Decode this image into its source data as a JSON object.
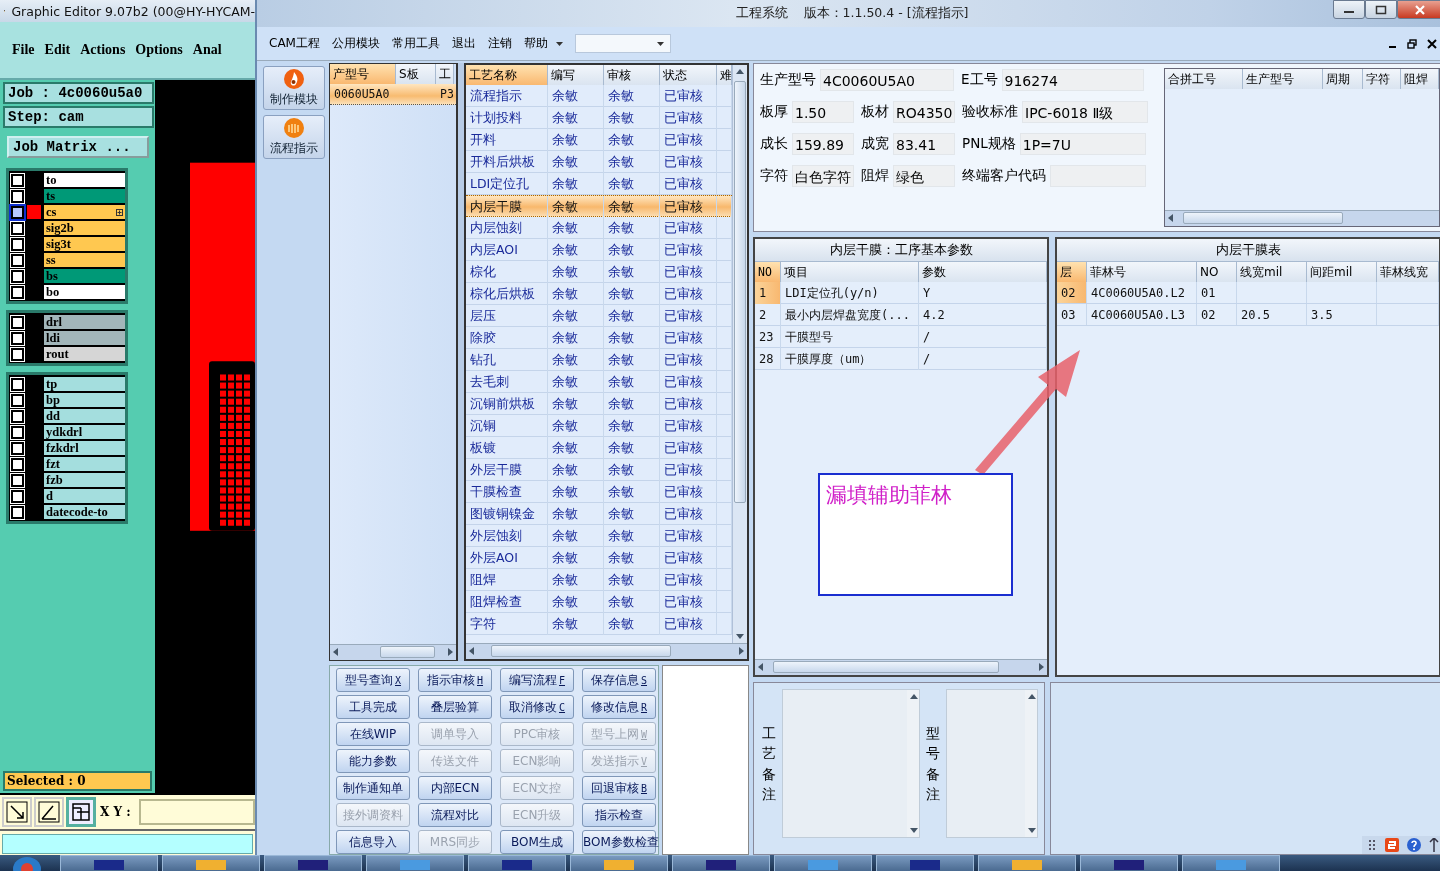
{
  "editor": {
    "title": "Graphic Editor 9.07b2 (00@HY-HYCAM-",
    "menu": [
      "File",
      "Edit",
      "Actions",
      "Options",
      "Anal"
    ],
    "job": "Job : 4c0060u5a0",
    "step": "Step: cam",
    "matrix_button": "Job Matrix ...",
    "layer_groups": [
      [
        {
          "name": "to",
          "color": "#ffffff",
          "selected": false
        },
        {
          "name": "ts",
          "color": "#009977",
          "selected": false
        },
        {
          "name": "cs",
          "color": "#ffc850",
          "selected": true
        },
        {
          "name": "sig2b",
          "color": "#ffc850",
          "selected": false
        },
        {
          "name": "sig3t",
          "color": "#ffc850",
          "selected": false
        },
        {
          "name": "ss",
          "color": "#ffc850",
          "selected": false
        },
        {
          "name": "bs",
          "color": "#009977",
          "selected": false
        },
        {
          "name": "bo",
          "color": "#ffffff",
          "selected": false
        }
      ],
      [
        {
          "name": "drl",
          "color": "#a2b6ba",
          "selected": false
        },
        {
          "name": "ldi",
          "color": "#a2b6ba",
          "selected": false
        },
        {
          "name": "rout",
          "color": "#d6d6d6",
          "selected": false
        }
      ],
      [
        {
          "name": "tp",
          "color": "#a4dede",
          "selected": false
        },
        {
          "name": "bp",
          "color": "#a4dede",
          "selected": false
        },
        {
          "name": "dd",
          "color": "#a4dede",
          "selected": false
        },
        {
          "name": "ydkdrl",
          "color": "#a4dede",
          "selected": false
        },
        {
          "name": "fzkdrl",
          "color": "#a4dede",
          "selected": false
        },
        {
          "name": "fzt",
          "color": "#a4dede",
          "selected": false
        },
        {
          "name": "fzb",
          "color": "#a4dede",
          "selected": false
        },
        {
          "name": "d",
          "color": "#a4dede",
          "selected": false
        },
        {
          "name": "datecode-to",
          "color": "#a4dede",
          "selected": false
        }
      ]
    ],
    "selected_count": "Selected : 0",
    "xy_label": "X Y :"
  },
  "app": {
    "title": "工程系统",
    "version": "版本：1.1.50.4 - [流程指示]",
    "menu": [
      "CAM工程",
      "公用模块",
      "常用工具",
      "退出",
      "注销",
      "帮助"
    ],
    "nav": [
      "制作模块",
      "流程指示"
    ],
    "products": {
      "columns": [
        "产型号",
        "S板",
        "工"
      ],
      "rows": [
        {
          "model": "0060U5A0",
          "column_3": "P3",
          "selected": true
        }
      ]
    },
    "process": {
      "columns": [
        "工艺名称",
        "编写",
        "审核",
        "状态",
        "难"
      ],
      "rows": [
        {
          "cells": [
            "流程指示",
            "余敏",
            "余敏",
            "已审核"
          ],
          "selected": false
        },
        {
          "cells": [
            "计划投料",
            "余敏",
            "余敏",
            "已审核"
          ],
          "selected": false
        },
        {
          "cells": [
            "开料",
            "余敏",
            "余敏",
            "已审核"
          ],
          "selected": false
        },
        {
          "cells": [
            "开料后烘板",
            "余敏",
            "余敏",
            "已审核"
          ],
          "selected": false
        },
        {
          "cells": [
            "LDI定位孔",
            "余敏",
            "余敏",
            "已审核"
          ],
          "selected": false
        },
        {
          "cells": [
            "内层干膜",
            "余敏",
            "余敏",
            "已审核"
          ],
          "selected": true
        },
        {
          "cells": [
            "内层蚀刻",
            "余敏",
            "余敏",
            "已审核"
          ],
          "selected": false
        },
        {
          "cells": [
            "内层AOI",
            "余敏",
            "余敏",
            "已审核"
          ],
          "selected": false
        },
        {
          "cells": [
            "棕化",
            "余敏",
            "余敏",
            "已审核"
          ],
          "selected": false
        },
        {
          "cells": [
            "棕化后烘板",
            "余敏",
            "余敏",
            "已审核"
          ],
          "selected": false
        },
        {
          "cells": [
            "层压",
            "余敏",
            "余敏",
            "已审核"
          ],
          "selected": false
        },
        {
          "cells": [
            "除胶",
            "余敏",
            "余敏",
            "已审核"
          ],
          "selected": false
        },
        {
          "cells": [
            "钻孔",
            "余敏",
            "余敏",
            "已审核"
          ],
          "selected": false
        },
        {
          "cells": [
            "去毛刺",
            "余敏",
            "余敏",
            "已审核"
          ],
          "selected": false
        },
        {
          "cells": [
            "沉铜前烘板",
            "余敏",
            "余敏",
            "已审核"
          ],
          "selected": false
        },
        {
          "cells": [
            "沉铜",
            "余敏",
            "余敏",
            "已审核"
          ],
          "selected": false
        },
        {
          "cells": [
            "板镀",
            "余敏",
            "余敏",
            "已审核"
          ],
          "selected": false
        },
        {
          "cells": [
            "外层干膜",
            "余敏",
            "余敏",
            "已审核"
          ],
          "selected": false
        },
        {
          "cells": [
            "干膜检查",
            "余敏",
            "余敏",
            "已审核"
          ],
          "selected": false
        },
        {
          "cells": [
            "图镀铜镍金",
            "余敏",
            "余敏",
            "已审核"
          ],
          "selected": false
        },
        {
          "cells": [
            "外层蚀刻",
            "余敏",
            "余敏",
            "已审核"
          ],
          "selected": false
        },
        {
          "cells": [
            "外层AOI",
            "余敏",
            "余敏",
            "已审核"
          ],
          "selected": false
        },
        {
          "cells": [
            "阻焊",
            "余敏",
            "余敏",
            "已审核"
          ],
          "selected": false
        },
        {
          "cells": [
            "阻焊检查",
            "余敏",
            "余敏",
            "已审核"
          ],
          "selected": false
        },
        {
          "cells": [
            "字符",
            "余敏",
            "余敏",
            "已审核"
          ],
          "selected": false
        }
      ]
    },
    "buttons": [
      {
        "label": "型号查询",
        "hotkey": "X",
        "disabled": false
      },
      {
        "label": "指示审核",
        "hotkey": "H",
        "disabled": false
      },
      {
        "label": "编写流程",
        "hotkey": "F",
        "disabled": false
      },
      {
        "label": "保存信息",
        "hotkey": "S",
        "disabled": false
      },
      {
        "label": "工具完成",
        "disabled": false
      },
      {
        "label": "叠层验算",
        "disabled": false
      },
      {
        "label": "取消修改",
        "hotkey": "C",
        "disabled": false
      },
      {
        "label": "修改信息",
        "hotkey": "R",
        "disabled": false
      },
      {
        "label": "在线WIP",
        "disabled": false
      },
      {
        "label": "调单导入",
        "disabled": true
      },
      {
        "label": "PPC审核",
        "disabled": true
      },
      {
        "label": "型号上网",
        "hotkey": "W",
        "disabled": true
      },
      {
        "label": "能力参数",
        "disabled": false
      },
      {
        "label": "传送文件",
        "disabled": true
      },
      {
        "label": "ECN影响",
        "disabled": true
      },
      {
        "label": "发送指示",
        "hotkey": "V",
        "disabled": true
      },
      {
        "label": "制作通知单",
        "disabled": false
      },
      {
        "label": "内部ECN",
        "disabled": false
      },
      {
        "label": "ECN文控",
        "disabled": true
      },
      {
        "label": "回退审核",
        "hotkey": "B",
        "disabled": false
      },
      {
        "label": "接外调资料",
        "disabled": true
      },
      {
        "label": "流程对比",
        "disabled": false
      },
      {
        "label": "ECN升级",
        "disabled": true
      },
      {
        "label": "指示检查",
        "disabled": false
      },
      {
        "label": "信息导入",
        "disabled": false
      },
      {
        "label": "MRS同步",
        "disabled": true
      },
      {
        "label": "BOM生成",
        "disabled": false
      },
      {
        "label": "BOM参数检查",
        "disabled": false
      }
    ],
    "info": [
      [
        {
          "label": "生产型号",
          "value": "4C0060U5A0"
        },
        {
          "label": "E工号",
          "value": "916274"
        }
      ],
      [
        {
          "label": "板厚",
          "value": "1.50"
        },
        {
          "label": "板材",
          "value": "RO4350"
        },
        {
          "label": "验收标准",
          "value": "IPC-6018 Ⅱ级"
        }
      ],
      [
        {
          "label": "成长",
          "value": "159.89"
        },
        {
          "label": "成宽",
          "value": "83.41"
        },
        {
          "label": "PNL规格",
          "value": "1P=7U"
        }
      ],
      [
        {
          "label": "字符",
          "value": "白色字符"
        },
        {
          "label": "阻焊",
          "value": "绿色"
        },
        {
          "label": "终端客户代码"
        }
      ]
    ],
    "merge_table": {
      "columns": [
        "合拼工号",
        "生产型号",
        "周期",
        "字符",
        "阻焊"
      ]
    },
    "params": {
      "title": "内层干膜：工序基本参数",
      "columns": [
        "NO",
        "项目",
        "参数"
      ],
      "rows": [
        {
          "cells": [
            "1",
            "LDI定位孔(y/n)",
            "Y"
          ],
          "selected": true
        },
        {
          "cells": [
            "2",
            "最小内层焊盘宽度(...",
            "4.2"
          ],
          "selected": false
        },
        {
          "cells": [
            "23",
            "干膜型号",
            "/"
          ],
          "selected": false
        },
        {
          "cells": [
            "28",
            "干膜厚度（um）",
            "/"
          ],
          "selected": false
        }
      ]
    },
    "film": {
      "title": "内层干膜表",
      "columns": [
        "层",
        "菲林号",
        "NO",
        "线宽mil",
        "间距mil",
        "菲林线宽"
      ],
      "rows": [
        {
          "cells": [
            "02",
            "4C0060U5A0.L2",
            "01",
            "",
            ""
          ],
          "selected": true
        },
        {
          "cells": [
            "03",
            "4C0060U5A0.L3",
            "02",
            "20.5",
            "3.5"
          ],
          "selected": false
        }
      ]
    },
    "annotation": "漏填辅助菲林",
    "remarks": [
      "工艺备注",
      "型号备注"
    ]
  }
}
